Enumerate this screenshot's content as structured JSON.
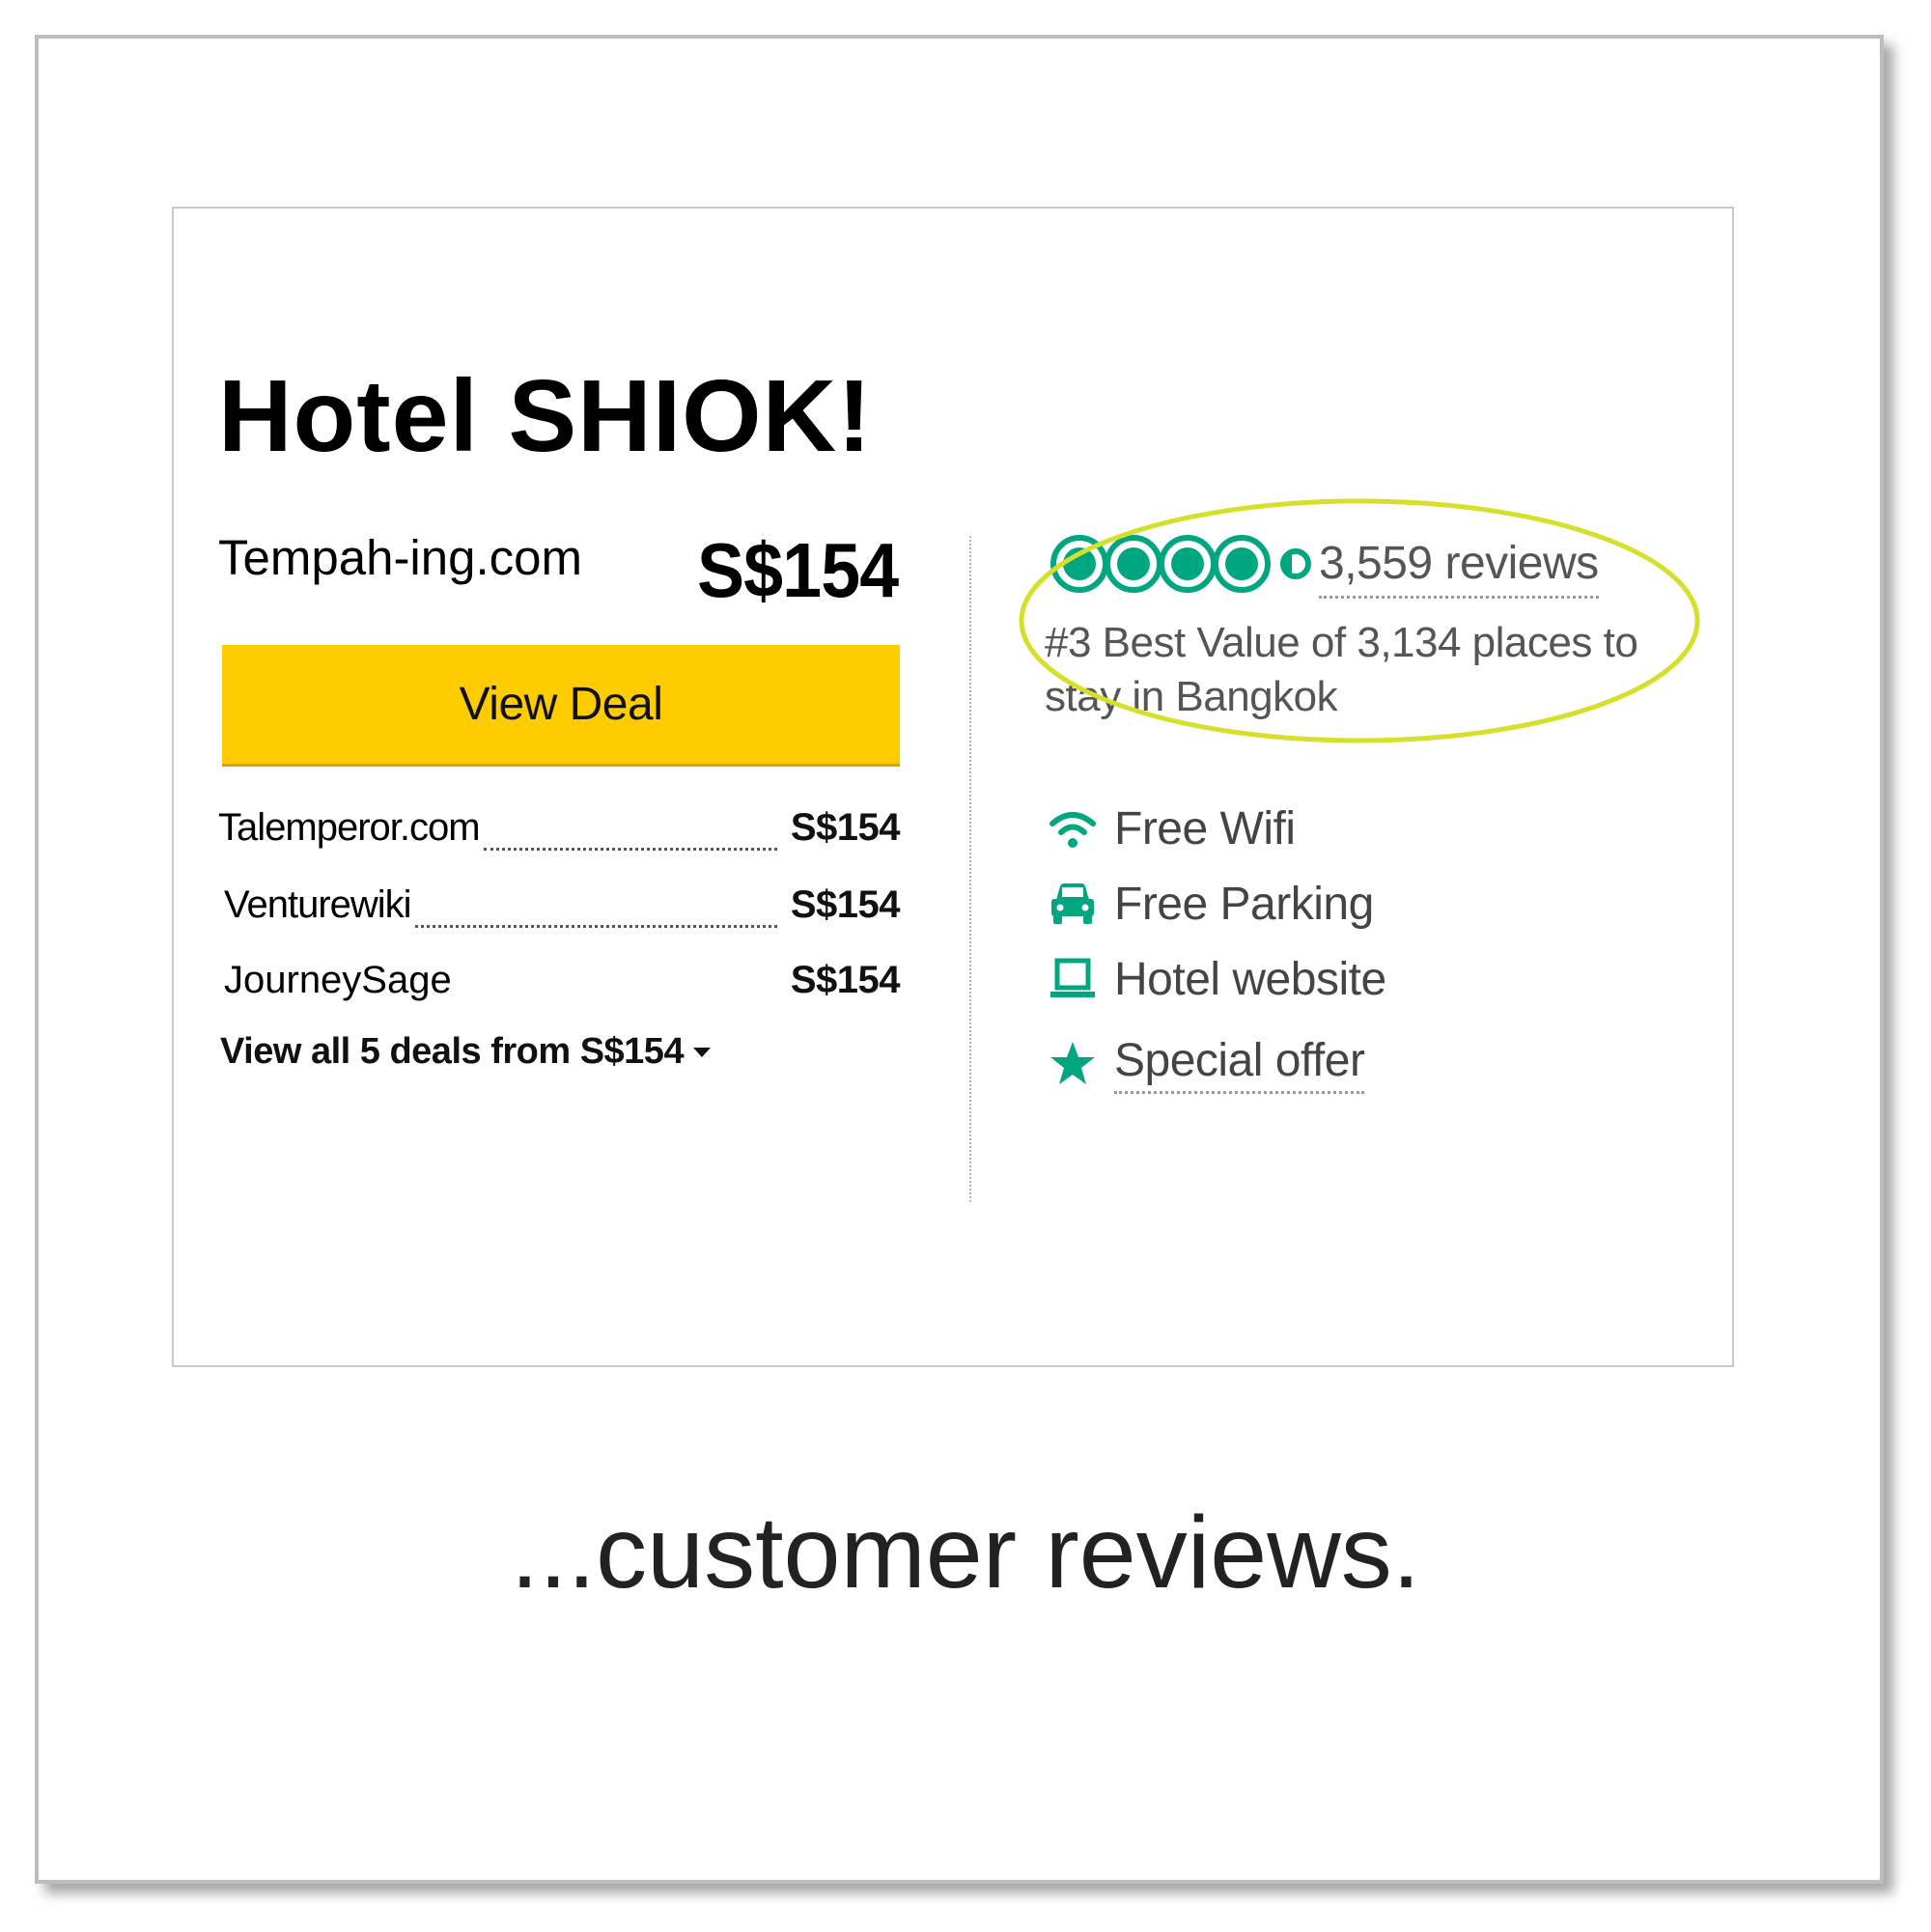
{
  "hotel": {
    "name": "Hotel SHIOK!",
    "main_provider": "Tempah-ing.com",
    "main_price": "S$154",
    "cta_label": "View Deal"
  },
  "deals": [
    {
      "provider": "Talemperor.com",
      "price": "S$154"
    },
    {
      "provider": "Venturewiki",
      "price": "S$154"
    },
    {
      "provider": "JourneySage",
      "price": "S$154"
    }
  ],
  "view_all_label": "View all 5 deals from S$154",
  "rating": {
    "bubbles": 4.5,
    "max": 5,
    "reviews_label": "3,559 reviews",
    "ranking_text": "#3 Best Value of 3,134 places to stay in Bangkok"
  },
  "amenities": [
    {
      "icon": "wifi-icon",
      "label": "Free Wifi"
    },
    {
      "icon": "car-icon",
      "label": "Free Parking"
    },
    {
      "icon": "laptop-icon",
      "label": "Hotel website"
    },
    {
      "icon": "star-icon",
      "label": "Special offer"
    }
  ],
  "colors": {
    "cta": "#ffcc00",
    "rating_green": "#00a680",
    "highlight_ring": "#d6e02a"
  },
  "caption": "...customer reviews."
}
